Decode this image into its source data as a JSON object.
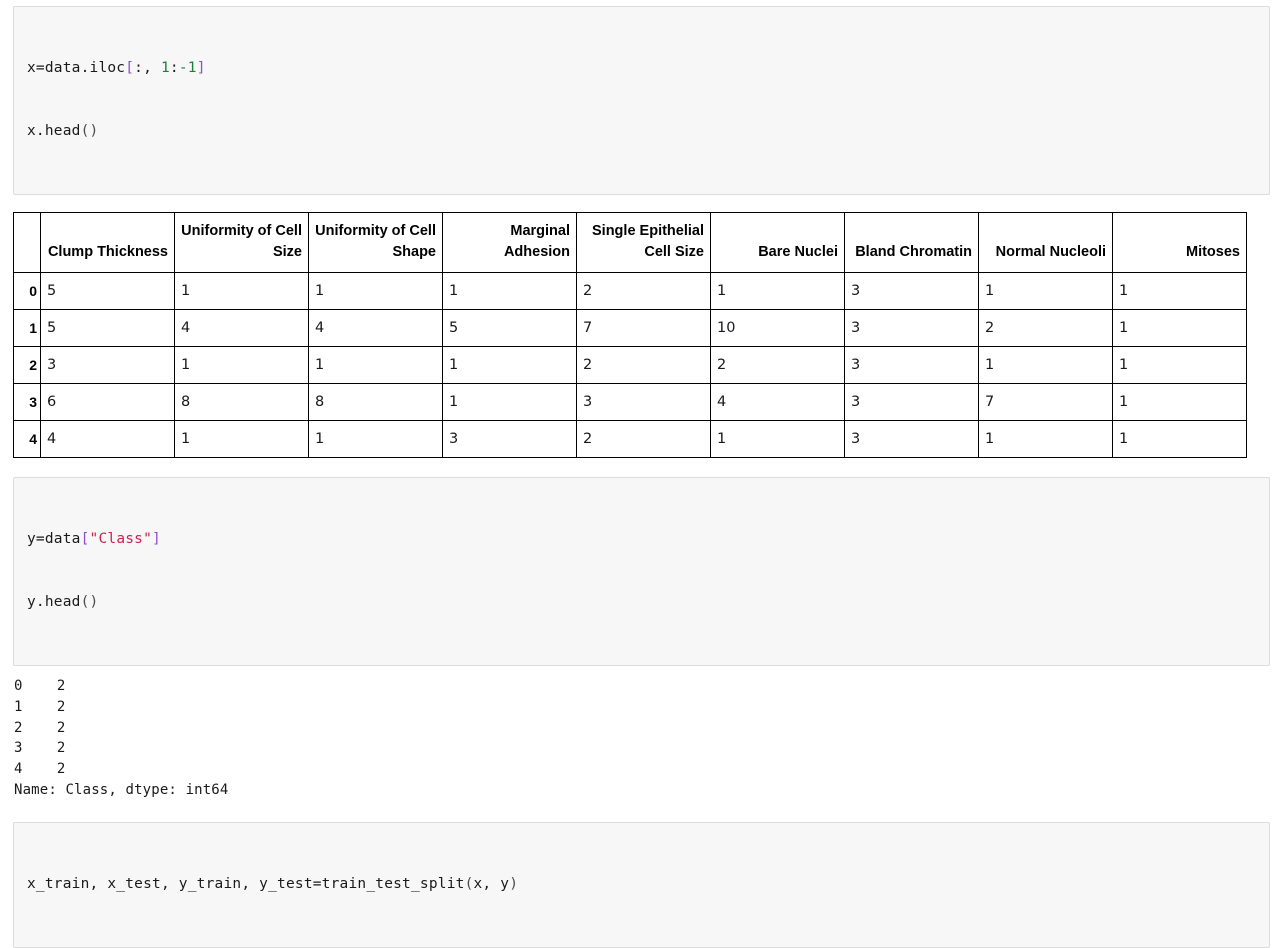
{
  "cells": [
    {
      "name": "code-cell-x-iloc",
      "lines": [
        [
          {
            "t": "x=data.iloc",
            "c": "plain"
          },
          {
            "t": "[",
            "c": "bracket"
          },
          {
            "t": ":",
            "c": "plain"
          },
          {
            "t": ", ",
            "c": "plain"
          },
          {
            "t": "1",
            "c": "num"
          },
          {
            "t": ":",
            "c": "plain"
          },
          {
            "t": "-1",
            "c": "num"
          },
          {
            "t": "]",
            "c": "bracket"
          }
        ],
        [
          {
            "t": "x.head",
            "c": "plain"
          },
          {
            "t": "()",
            "c": "paren"
          }
        ]
      ]
    },
    {
      "name": "code-cell-y-class",
      "lines": [
        [
          {
            "t": "y=data",
            "c": "plain"
          },
          {
            "t": "[",
            "c": "bracket"
          },
          {
            "t": "\"Class\"",
            "c": "str"
          },
          {
            "t": "]",
            "c": "bracket"
          }
        ],
        [
          {
            "t": "y.head",
            "c": "plain"
          },
          {
            "t": "()",
            "c": "paren"
          }
        ]
      ]
    },
    {
      "name": "code-cell-train-test-split",
      "lines": [
        [
          {
            "t": "x_train, x_test, y_train, y_test=train_test_split",
            "c": "plain"
          },
          {
            "t": "(",
            "c": "paren"
          },
          {
            "t": "x, y",
            "c": "plain"
          },
          {
            "t": ")",
            "c": "paren"
          }
        ]
      ]
    }
  ],
  "dataframe": {
    "index_header": "",
    "columns": [
      "Clump Thickness",
      "Uniformity of Cell Size",
      "Uniformity of Cell Shape",
      "Marginal Adhesion",
      "Single Epithelial Cell Size",
      "Bare Nuclei",
      "Bland Chromatin",
      "Normal Nucleoli",
      "Mitoses"
    ],
    "index": [
      "0",
      "1",
      "2",
      "3",
      "4"
    ],
    "rows": [
      [
        "5",
        "1",
        "1",
        "1",
        "2",
        "1",
        "3",
        "1",
        "1"
      ],
      [
        "5",
        "4",
        "4",
        "5",
        "7",
        "10",
        "3",
        "2",
        "1"
      ],
      [
        "3",
        "1",
        "1",
        "1",
        "2",
        "2",
        "3",
        "1",
        "1"
      ],
      [
        "6",
        "8",
        "8",
        "1",
        "3",
        "4",
        "3",
        "7",
        "1"
      ],
      [
        "4",
        "1",
        "1",
        "3",
        "2",
        "1",
        "3",
        "1",
        "1"
      ]
    ]
  },
  "series_output": {
    "name": "series-head-output",
    "text": "0    2\n1    2\n2    2\n3    2\n4    2\nName: Class, dtype: int64"
  },
  "colors": {
    "cell_background": "#f7f7f7",
    "cell_border": "#dcdcdc",
    "string_token": "#c7254e",
    "bracket_token": "#8b4fc9",
    "number_token": "#1a7f37",
    "table_border": "#000000",
    "text": "#1a1a1a"
  }
}
